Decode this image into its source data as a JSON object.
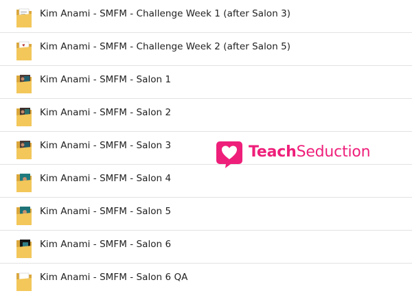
{
  "files": [
    {
      "name": "Kim Anami - SMFM - Challenge Week 1 (after Salon 3)",
      "thumb": "document"
    },
    {
      "name": "Kim Anami - SMFM - Challenge Week 2 (after Salon 5)",
      "thumb": "document-red"
    },
    {
      "name": "Kim Anami - SMFM - Salon 1",
      "thumb": "photo-dark"
    },
    {
      "name": "Kim Anami - SMFM - Salon 2",
      "thumb": "photo-dark"
    },
    {
      "name": "Kim Anami - SMFM - Salon 3",
      "thumb": "photo-dark"
    },
    {
      "name": "Kim Anami - SMFM - Salon 4",
      "thumb": "photo-teal"
    },
    {
      "name": "Kim Anami - SMFM - Salon 5",
      "thumb": "photo-teal"
    },
    {
      "name": "Kim Anami - SMFM - Salon 6",
      "thumb": "photo-black"
    },
    {
      "name": "Kim Anami - SMFM - Salon 6 QA",
      "thumb": "folder-plain"
    }
  ],
  "watermark": {
    "bold": "Teach",
    "regular": "Seduction",
    "icon": "heart-speech-bubble-icon",
    "color": "#ee1f7a"
  },
  "colors": {
    "folder": "#f3c75a",
    "folder_dark": "#dba73c",
    "text": "#1e1e1e",
    "divider": "#e2e2e2"
  }
}
